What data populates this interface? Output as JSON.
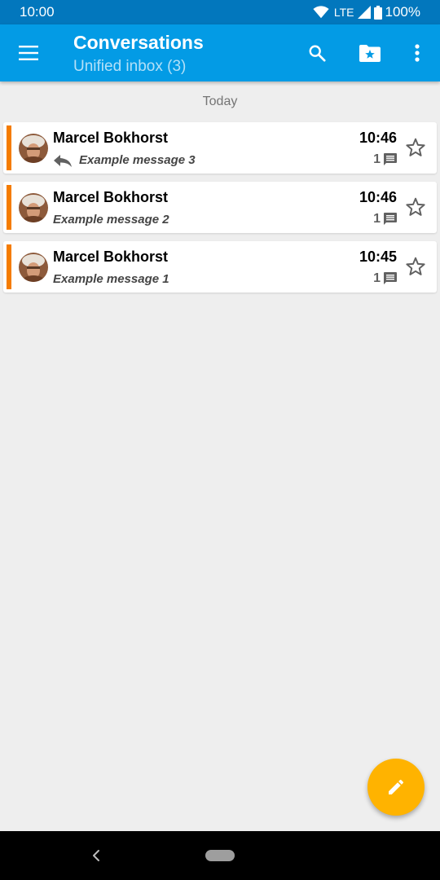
{
  "status_bar": {
    "time": "10:00",
    "network": "LTE",
    "battery": "100%"
  },
  "app_bar": {
    "title": "Conversations",
    "subtitle": "Unified inbox (3)"
  },
  "list": {
    "section_header": "Today",
    "messages": [
      {
        "from": "Marcel Bokhorst",
        "subject": "Example message 3",
        "time": "10:46",
        "count": "1",
        "answered": true,
        "starred": false
      },
      {
        "from": "Marcel Bokhorst",
        "subject": "Example message 2",
        "time": "10:46",
        "count": "1",
        "answered": false,
        "starred": false
      },
      {
        "from": "Marcel Bokhorst",
        "subject": "Example message 1",
        "time": "10:45",
        "count": "1",
        "answered": false,
        "starred": false
      }
    ]
  },
  "icons": {
    "menu": "menu-icon",
    "search": "search-icon",
    "folder": "folder-star-icon",
    "more": "more-vert-icon",
    "reply": "reply-icon",
    "comment": "comment-icon",
    "star": "star-outline-icon",
    "compose": "pencil-icon"
  },
  "colors": {
    "status_bar": "#0277bd",
    "app_bar": "#039be5",
    "accent_bar": "#f57c00",
    "fab": "#ffb300",
    "background": "#eeeeee"
  }
}
